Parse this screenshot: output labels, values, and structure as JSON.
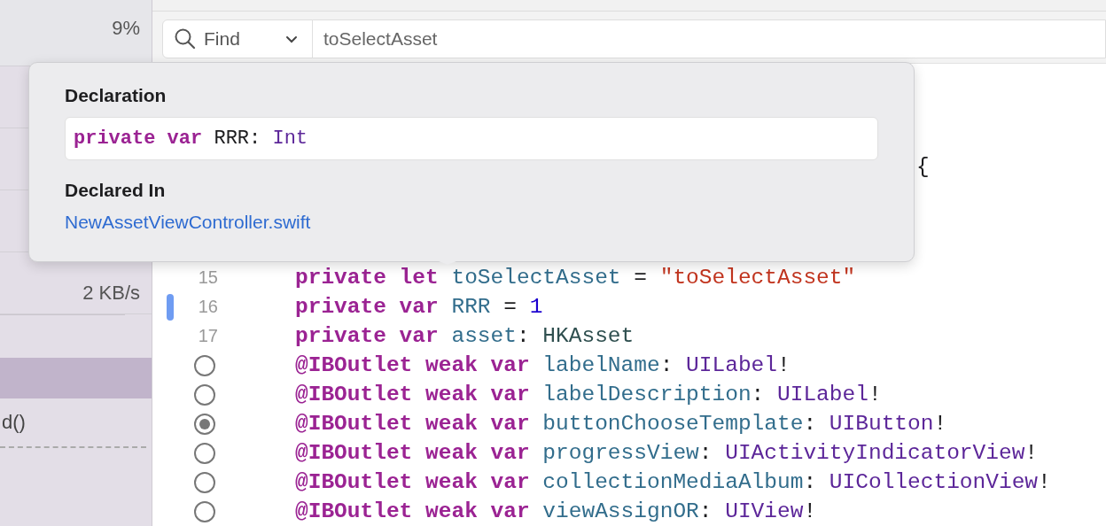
{
  "sidebar": {
    "stats": [
      "9%",
      "2 KB/s"
    ],
    "rows": [
      {
        "selected": true
      },
      {
        "label": "d()",
        "selected": false
      }
    ]
  },
  "find_bar": {
    "mode": "Find",
    "query": "toSelectAsset"
  },
  "editor": {
    "visible_fragment": "{",
    "lines": [
      {
        "kind": "number",
        "number": "15",
        "changed": false,
        "tokens": [
          {
            "t": "private let ",
            "kind": "keyword"
          },
          {
            "t": "toSelectAsset",
            "kind": "property"
          },
          {
            "t": " = ",
            "kind": "plain"
          },
          {
            "t": "\"toSelectAsset\"",
            "kind": "string"
          }
        ]
      },
      {
        "kind": "number",
        "number": "16",
        "changed": true,
        "tokens": [
          {
            "t": "private var ",
            "kind": "keyword"
          },
          {
            "t": "RRR",
            "kind": "property"
          },
          {
            "t": " = ",
            "kind": "plain"
          },
          {
            "t": "1",
            "kind": "number"
          }
        ]
      },
      {
        "kind": "number",
        "number": "17",
        "changed": false,
        "tokens": [
          {
            "t": "private var ",
            "kind": "keyword"
          },
          {
            "t": "asset",
            "kind": "property"
          },
          {
            "t": ": ",
            "kind": "plain"
          },
          {
            "t": "HKAsset",
            "kind": "project_type"
          }
        ]
      },
      {
        "kind": "outlet",
        "connected": false,
        "changed": false,
        "tokens": [
          {
            "t": "@IBOutlet weak var ",
            "kind": "keyword"
          },
          {
            "t": "labelName",
            "kind": "property"
          },
          {
            "t": ": ",
            "kind": "plain"
          },
          {
            "t": "UILabel",
            "kind": "type"
          },
          {
            "t": "!",
            "kind": "plain"
          }
        ]
      },
      {
        "kind": "outlet",
        "connected": false,
        "changed": false,
        "tokens": [
          {
            "t": "@IBOutlet weak var ",
            "kind": "keyword"
          },
          {
            "t": "labelDescription",
            "kind": "property"
          },
          {
            "t": ": ",
            "kind": "plain"
          },
          {
            "t": "UILabel",
            "kind": "type"
          },
          {
            "t": "!",
            "kind": "plain"
          }
        ]
      },
      {
        "kind": "outlet",
        "connected": true,
        "changed": false,
        "tokens": [
          {
            "t": "@IBOutlet weak var ",
            "kind": "keyword"
          },
          {
            "t": "buttonChooseTemplate",
            "kind": "property"
          },
          {
            "t": ": ",
            "kind": "plain"
          },
          {
            "t": "UIButton",
            "kind": "type"
          },
          {
            "t": "!",
            "kind": "plain"
          }
        ]
      },
      {
        "kind": "outlet",
        "connected": false,
        "changed": false,
        "tokens": [
          {
            "t": "@IBOutlet weak var ",
            "kind": "keyword"
          },
          {
            "t": "progressView",
            "kind": "property"
          },
          {
            "t": ": ",
            "kind": "plain"
          },
          {
            "t": "UIActivityIndicatorView",
            "kind": "type"
          },
          {
            "t": "!",
            "kind": "plain"
          }
        ]
      },
      {
        "kind": "outlet",
        "connected": false,
        "changed": false,
        "tokens": [
          {
            "t": "@IBOutlet weak var ",
            "kind": "keyword"
          },
          {
            "t": "collectionMediaAlbum",
            "kind": "property"
          },
          {
            "t": ": ",
            "kind": "plain"
          },
          {
            "t": "UICollectionView",
            "kind": "type"
          },
          {
            "t": "!",
            "kind": "plain"
          }
        ]
      },
      {
        "kind": "outlet",
        "connected": false,
        "changed": false,
        "tokens": [
          {
            "t": "@IBOutlet weak var ",
            "kind": "keyword"
          },
          {
            "t": "viewAssignOR",
            "kind": "property"
          },
          {
            "t": ": ",
            "kind": "plain"
          },
          {
            "t": "UIView",
            "kind": "type"
          },
          {
            "t": "!",
            "kind": "plain"
          }
        ]
      }
    ]
  },
  "quick_help": {
    "declaration_heading": "Declaration",
    "declaration": [
      {
        "t": "private var ",
        "kind": "keyword"
      },
      {
        "t": "RRR",
        "kind": "plain"
      },
      {
        "t": ": ",
        "kind": "plain"
      },
      {
        "t": "Int",
        "kind": "type"
      }
    ],
    "declared_in_heading": "Declared In",
    "file_link": "NewAssetViewController.swift"
  }
}
